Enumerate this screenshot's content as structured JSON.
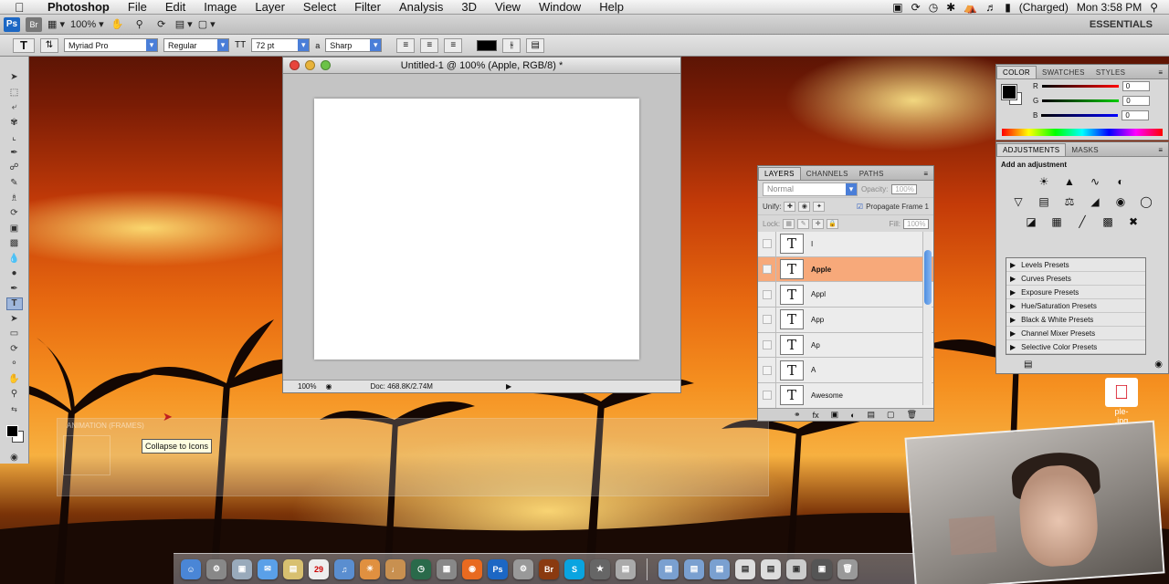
{
  "menubar": {
    "app": "Photoshop",
    "items": [
      "File",
      "Edit",
      "Image",
      "Layer",
      "Select",
      "Filter",
      "Analysis",
      "3D",
      "View",
      "Window",
      "Help"
    ],
    "battery": "(Charged)",
    "clock": "Mon 3:58 PM"
  },
  "appbar": {
    "ps": "Ps",
    "br": "Br",
    "zoom": "100%",
    "workspace": "ESSENTIALS"
  },
  "options": {
    "font_family": "Myriad Pro",
    "font_style": "Regular",
    "font_size": "72 pt",
    "antialias_label": "a",
    "antialias": "Sharp"
  },
  "document": {
    "title": "Untitled-1 @ 100% (Apple, RGB/8) *",
    "zoom": "100%",
    "doc_info": "Doc: 468.8K/2.74M"
  },
  "layers_panel": {
    "tabs": [
      "LAYERS",
      "CHANNELS",
      "PATHS"
    ],
    "blend_mode": "Normal",
    "opacity_label": "Opacity:",
    "opacity": "100%",
    "unify_label": "Unify:",
    "propagate": "Propagate Frame 1",
    "lock_label": "Lock:",
    "fill_label": "Fill:",
    "fill": "100%",
    "layers": [
      {
        "name": "I",
        "selected": false
      },
      {
        "name": "Apple",
        "selected": true
      },
      {
        "name": "Appl",
        "selected": false
      },
      {
        "name": "App",
        "selected": false
      },
      {
        "name": "Ap",
        "selected": false
      },
      {
        "name": "A",
        "selected": false
      },
      {
        "name": "Awesome",
        "selected": false
      }
    ]
  },
  "color_panel": {
    "tabs": [
      "COLOR",
      "SWATCHES",
      "STYLES"
    ],
    "r_label": "R",
    "r": "0",
    "g_label": "G",
    "g": "0",
    "b_label": "B",
    "b": "0"
  },
  "adjustments_panel": {
    "tabs": [
      "ADJUSTMENTS",
      "MASKS"
    ],
    "title": "Add an adjustment",
    "presets": [
      "Levels Presets",
      "Curves Presets",
      "Exposure Presets",
      "Hue/Saturation Presets",
      "Black & White Presets",
      "Channel Mixer Presets",
      "Selective Color Presets"
    ]
  },
  "animation_panel": {
    "tab": "ANIMATION (FRAMES)"
  },
  "tooltip": "Collapse to Icons",
  "desktop_icon": {
    "label": "ple-\n.jpg"
  },
  "colors": {
    "selected_layer": "#f7a97a",
    "scroll_thumb": "#4d8ee0",
    "ps_blue": "#1c67c4"
  }
}
